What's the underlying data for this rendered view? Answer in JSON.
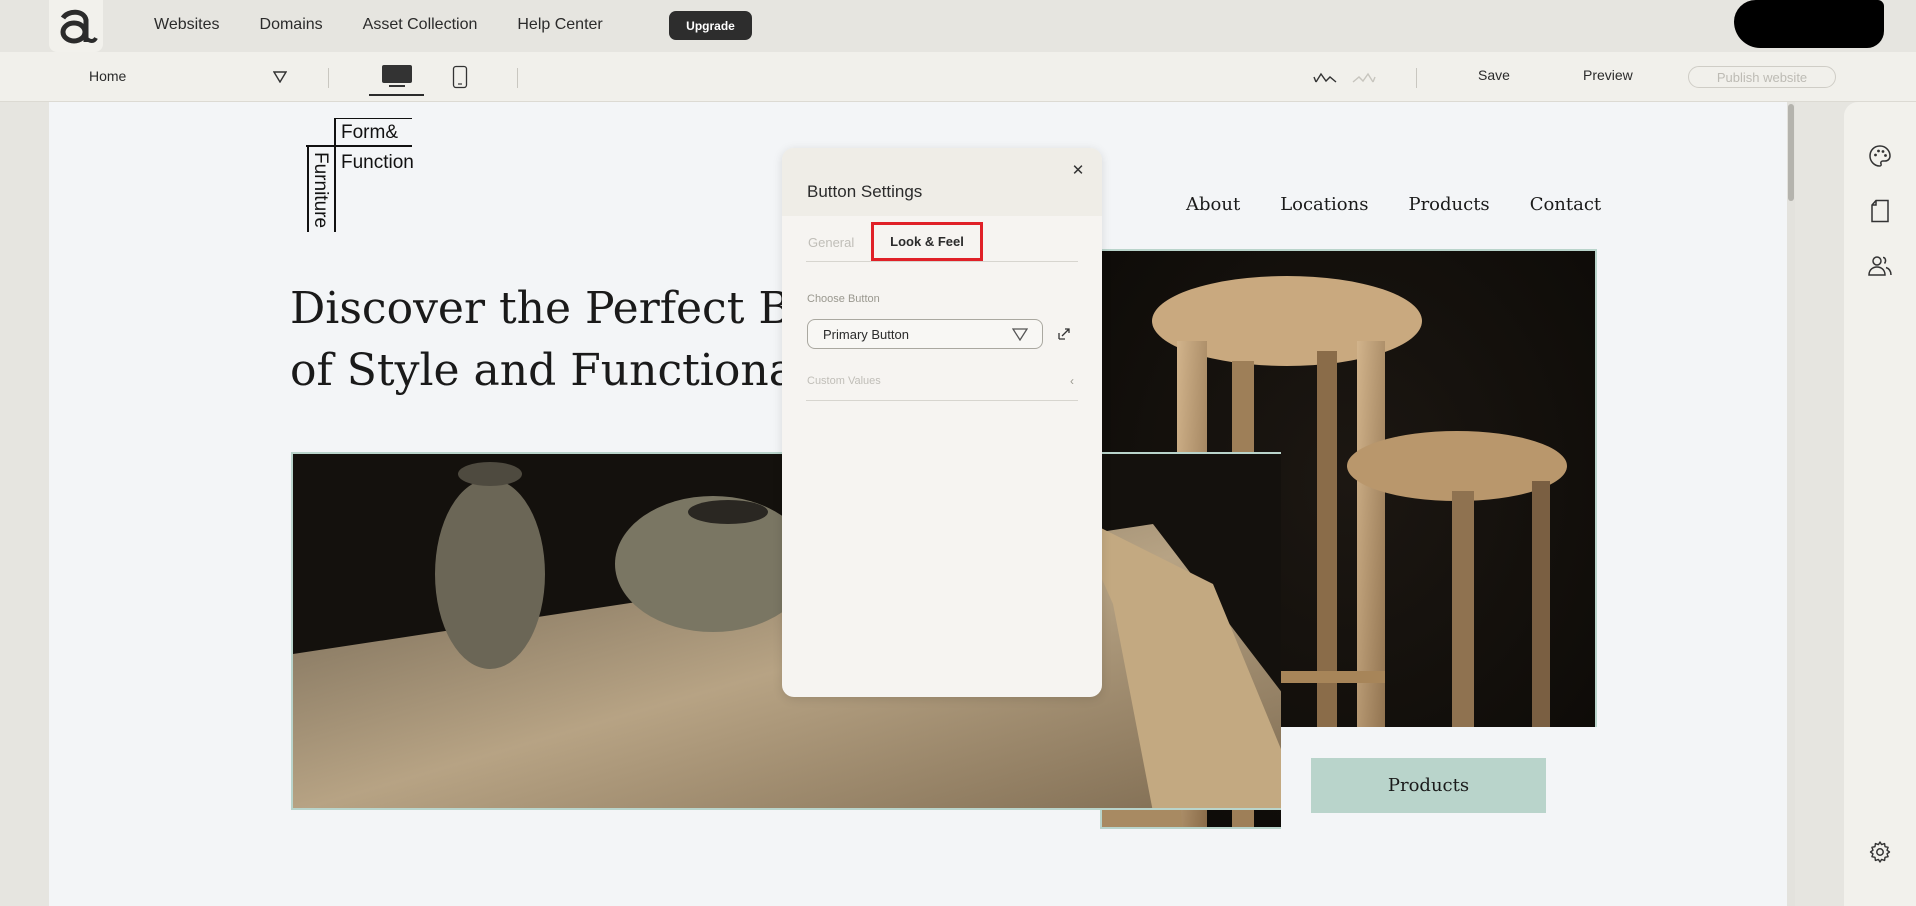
{
  "topbar": {
    "nav": [
      "Websites",
      "Domains",
      "Asset Collection",
      "Help Center"
    ],
    "upgrade_label": "Upgrade"
  },
  "toolbar": {
    "page": "Home",
    "save_label": "Save",
    "preview_label": "Preview",
    "publish_label": "Publish website"
  },
  "site": {
    "logo_lines": [
      "Form&",
      "Function",
      "Furniture"
    ],
    "nav": [
      "About",
      "Locations",
      "Products",
      "Contact"
    ],
    "hero_title_line1": "Discover the Perfect Bl",
    "hero_title_line2": "of Style and Functiona",
    "cta_label": "Products"
  },
  "panel": {
    "title": "Button Settings",
    "tabs": [
      "General",
      "Look & Feel"
    ],
    "active_tab": "Look & Feel",
    "choose_label": "Choose Button",
    "choose_value": "Primary Button",
    "custom_label": "Custom Values"
  },
  "colors": {
    "accent_green": "#b9d4cb",
    "highlight_red": "#e02027",
    "dark_button": "#2d2d2d"
  }
}
